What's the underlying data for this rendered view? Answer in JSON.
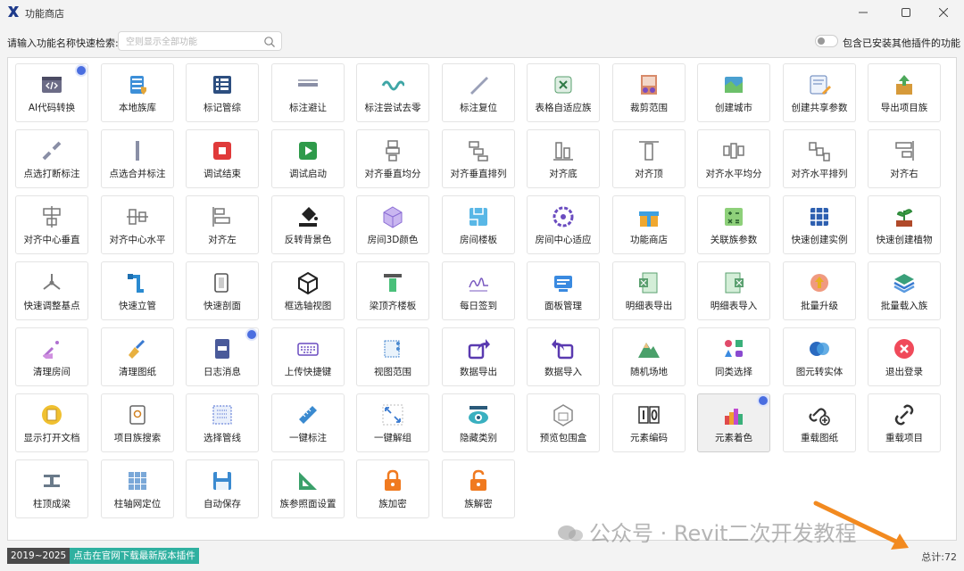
{
  "window": {
    "title": "功能商店",
    "minimize_icon": "minimize-icon",
    "maximize_icon": "maximize-icon",
    "close_icon": "close-icon"
  },
  "search": {
    "label": "请输入功能名称快速检索:",
    "value": "",
    "placeholder": "空则显示全部功能"
  },
  "toggle": {
    "label": "包含已安装其他插件的功能",
    "on": false
  },
  "tiles": [
    {
      "label": "AI代码转换",
      "icon": "code-window-icon",
      "dot": true
    },
    {
      "label": "本地族库",
      "icon": "database-shield-icon",
      "dot": false
    },
    {
      "label": "标记管综",
      "icon": "list-panel-icon",
      "dot": false
    },
    {
      "label": "标注避让",
      "icon": "dimension-line-icon",
      "dot": false
    },
    {
      "label": "标注尝试去零",
      "icon": "wave-line-icon",
      "dot": false
    },
    {
      "label": "标注复位",
      "icon": "diagonal-ruler-icon",
      "dot": false
    },
    {
      "label": "表格自适应族",
      "icon": "table-fit-icon",
      "dot": false
    },
    {
      "label": "裁剪范围",
      "icon": "scissors-frame-icon",
      "dot": false
    },
    {
      "label": "创建城市",
      "icon": "map-city-icon",
      "dot": false
    },
    {
      "label": "创建共享参数",
      "icon": "form-pencil-icon",
      "dot": false
    },
    {
      "label": "导出项目族",
      "icon": "box-export-icon",
      "dot": false
    },
    {
      "label": "点选打断标注",
      "icon": "break-dimension-icon",
      "dot": false
    },
    {
      "label": "点选合并标注",
      "icon": "merge-dimension-icon",
      "dot": false
    },
    {
      "label": "调试结束",
      "icon": "stop-icon",
      "dot": false
    },
    {
      "label": "调试启动",
      "icon": "play-icon",
      "dot": false
    },
    {
      "label": "对齐垂直均分",
      "icon": "align-vertical-distribute-icon",
      "dot": false
    },
    {
      "label": "对齐垂直排列",
      "icon": "align-vertical-stack-icon",
      "dot": false
    },
    {
      "label": "对齐底",
      "icon": "align-bottom-icon",
      "dot": false
    },
    {
      "label": "对齐顶",
      "icon": "align-top-icon",
      "dot": false
    },
    {
      "label": "对齐水平均分",
      "icon": "align-horizontal-distribute-icon",
      "dot": false
    },
    {
      "label": "对齐水平排列",
      "icon": "align-horizontal-stack-icon",
      "dot": false
    },
    {
      "label": "对齐右",
      "icon": "align-right-icon",
      "dot": false
    },
    {
      "label": "对齐中心垂直",
      "icon": "align-center-vertical-icon",
      "dot": false
    },
    {
      "label": "对齐中心水平",
      "icon": "align-center-horizontal-icon",
      "dot": false
    },
    {
      "label": "对齐左",
      "icon": "align-left-icon",
      "dot": false
    },
    {
      "label": "反转背景色",
      "icon": "paint-bucket-icon",
      "dot": false
    },
    {
      "label": "房间3D颜色",
      "icon": "cube-3d-icon",
      "dot": false
    },
    {
      "label": "房间楼板",
      "icon": "room-floor-icon",
      "dot": false
    },
    {
      "label": "房间中心适应",
      "icon": "target-circle-icon",
      "dot": false
    },
    {
      "label": "功能商店",
      "icon": "gift-box-icon",
      "dot": false
    },
    {
      "label": "关联族参数",
      "icon": "calculator-icon",
      "dot": false
    },
    {
      "label": "快速创建实例",
      "icon": "grid-hash-icon",
      "dot": false
    },
    {
      "label": "快速创建植物",
      "icon": "plant-pot-icon",
      "dot": false
    },
    {
      "label": "快速调整基点",
      "icon": "axis-origin-icon",
      "dot": false
    },
    {
      "label": "快速立管",
      "icon": "faucet-pipe-icon",
      "dot": false
    },
    {
      "label": "快速剖面",
      "icon": "section-box-icon",
      "dot": false
    },
    {
      "label": "框选轴视图",
      "icon": "cube-outline-icon",
      "dot": false
    },
    {
      "label": "梁顶齐楼板",
      "icon": "beam-align-icon",
      "dot": false
    },
    {
      "label": "每日签到",
      "icon": "signature-icon",
      "dot": false
    },
    {
      "label": "面板管理",
      "icon": "panel-manage-icon",
      "dot": false
    },
    {
      "label": "明细表导出",
      "icon": "excel-export-icon",
      "dot": false
    },
    {
      "label": "明细表导入",
      "icon": "excel-import-icon",
      "dot": false
    },
    {
      "label": "批量升级",
      "icon": "upgrade-arrow-icon",
      "dot": false
    },
    {
      "label": "批量载入族",
      "icon": "layers-icon",
      "dot": false
    },
    {
      "label": "清理房间",
      "icon": "broom-room-icon",
      "dot": false
    },
    {
      "label": "清理图纸",
      "icon": "broom-icon",
      "dot": false
    },
    {
      "label": "日志消息",
      "icon": "log-file-icon",
      "dot": true
    },
    {
      "label": "上传快捷键",
      "icon": "keyboard-icon",
      "dot": false
    },
    {
      "label": "视图范围",
      "icon": "view-range-icon",
      "dot": false
    },
    {
      "label": "数据导出",
      "icon": "share-out-icon",
      "dot": false
    },
    {
      "label": "数据导入",
      "icon": "share-in-icon",
      "dot": false
    },
    {
      "label": "随机场地",
      "icon": "mountain-icon",
      "dot": false
    },
    {
      "label": "同类选择",
      "icon": "shapes-icon",
      "dot": false
    },
    {
      "label": "图元转实体",
      "icon": "solid-circles-icon",
      "dot": false
    },
    {
      "label": "退出登录",
      "icon": "logout-x-icon",
      "dot": false
    },
    {
      "label": "显示打开文档",
      "icon": "document-open-icon",
      "dot": false
    },
    {
      "label": "项目族搜索",
      "icon": "family-search-icon",
      "dot": false
    },
    {
      "label": "选择管线",
      "icon": "select-dashed-icon",
      "dot": false
    },
    {
      "label": "一键标注",
      "icon": "ruler-icon",
      "dot": false
    },
    {
      "label": "一键解组",
      "icon": "ungroup-icon",
      "dot": false
    },
    {
      "label": "隐藏类别",
      "icon": "eye-icon",
      "dot": false
    },
    {
      "label": "预览包围盒",
      "icon": "bounding-box-icon",
      "dot": false
    },
    {
      "label": "元素编码",
      "icon": "code-10-icon",
      "dot": false
    },
    {
      "label": "元素着色",
      "icon": "color-palette-icon",
      "dot": true,
      "selected": true
    },
    {
      "label": "重载图纸",
      "icon": "link-add-icon",
      "dot": false
    },
    {
      "label": "重载项目",
      "icon": "link-icon",
      "dot": false
    },
    {
      "label": "柱顶成梁",
      "icon": "steel-beam-icon",
      "dot": false
    },
    {
      "label": "柱轴网定位",
      "icon": "grid-tiles-icon",
      "dot": false
    },
    {
      "label": "自动保存",
      "icon": "save-disk-icon",
      "dot": false
    },
    {
      "label": "族参照面设置",
      "icon": "set-square-icon",
      "dot": false
    },
    {
      "label": "族加密",
      "icon": "lock-icon",
      "dot": false
    },
    {
      "label": "族解密",
      "icon": "unlock-icon",
      "dot": false
    }
  ],
  "footer": {
    "version": "2019~2025",
    "download_link": "点击在官网下载最新版本插件",
    "total": "总计:72"
  },
  "watermark": "公众号 · Revit二次开发教程",
  "colors": {
    "accent_dot": "#4a6ee0",
    "download_bg": "#2fb0a0",
    "version_bg": "#4a4a4a",
    "arrow": "#f28a20"
  }
}
